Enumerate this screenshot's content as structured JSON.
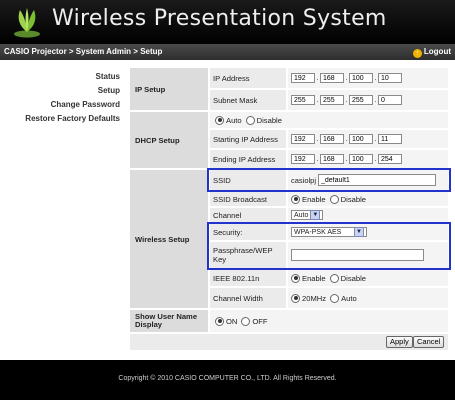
{
  "header": {
    "title": "Wireless Presentation System",
    "logo_icon": "wifi-logo-icon"
  },
  "navbar": {
    "breadcrumb": "CASIO Projector > System Admin > Setup",
    "logout": "Logout"
  },
  "sidebar": {
    "items": [
      {
        "label": "Status"
      },
      {
        "label": "Setup"
      },
      {
        "label": "Change Password"
      },
      {
        "label": "Restore Factory Defaults"
      }
    ]
  },
  "ip_setup": {
    "section": "IP Setup",
    "address_label": "IP Address",
    "address": [
      "192",
      "168",
      "100",
      "10"
    ],
    "mask_label": "Subnet Mask",
    "mask": [
      "255",
      "255",
      "255",
      "0"
    ]
  },
  "dhcp": {
    "section": "DHCP Setup",
    "auto": "Auto",
    "disable": "Disable",
    "start_label": "Starting IP Address",
    "start": [
      "192",
      "168",
      "100",
      "11"
    ],
    "end_label": "Ending IP Address",
    "end": [
      "192",
      "168",
      "100",
      "254"
    ]
  },
  "wireless": {
    "section": "Wireless Setup",
    "ssid_label": "SSID",
    "ssid_prefix": "casiolpj",
    "ssid_value": "_default1",
    "broadcast_label": "SSID Broadcast",
    "enable": "Enable",
    "disable": "Disable",
    "channel_label": "Channel",
    "channel_value": "Auto",
    "security_label": "Security:",
    "security_value": "WPA-PSK AES",
    "pass_label": "Passphrase/WEP Key",
    "pass_value": "",
    "ieee_label": "IEEE 802.11n",
    "ieee_enable": "Enable",
    "ieee_disable": "Disable",
    "width_label": "Channel Width",
    "width_20": "20MHz",
    "width_auto": "Auto"
  },
  "username": {
    "section": "Show User Name Display",
    "on": "ON",
    "off": "OFF"
  },
  "buttons": {
    "apply": "Apply",
    "cancel": "Cancel"
  },
  "footer": {
    "copyright": "Copyright © 2010 CASIO COMPUTER CO., LTD. All Rights Reserved."
  },
  "colors": {
    "highlight": "#2233cc",
    "header_bg": "#000000",
    "logout_icon": "#f0b400"
  }
}
